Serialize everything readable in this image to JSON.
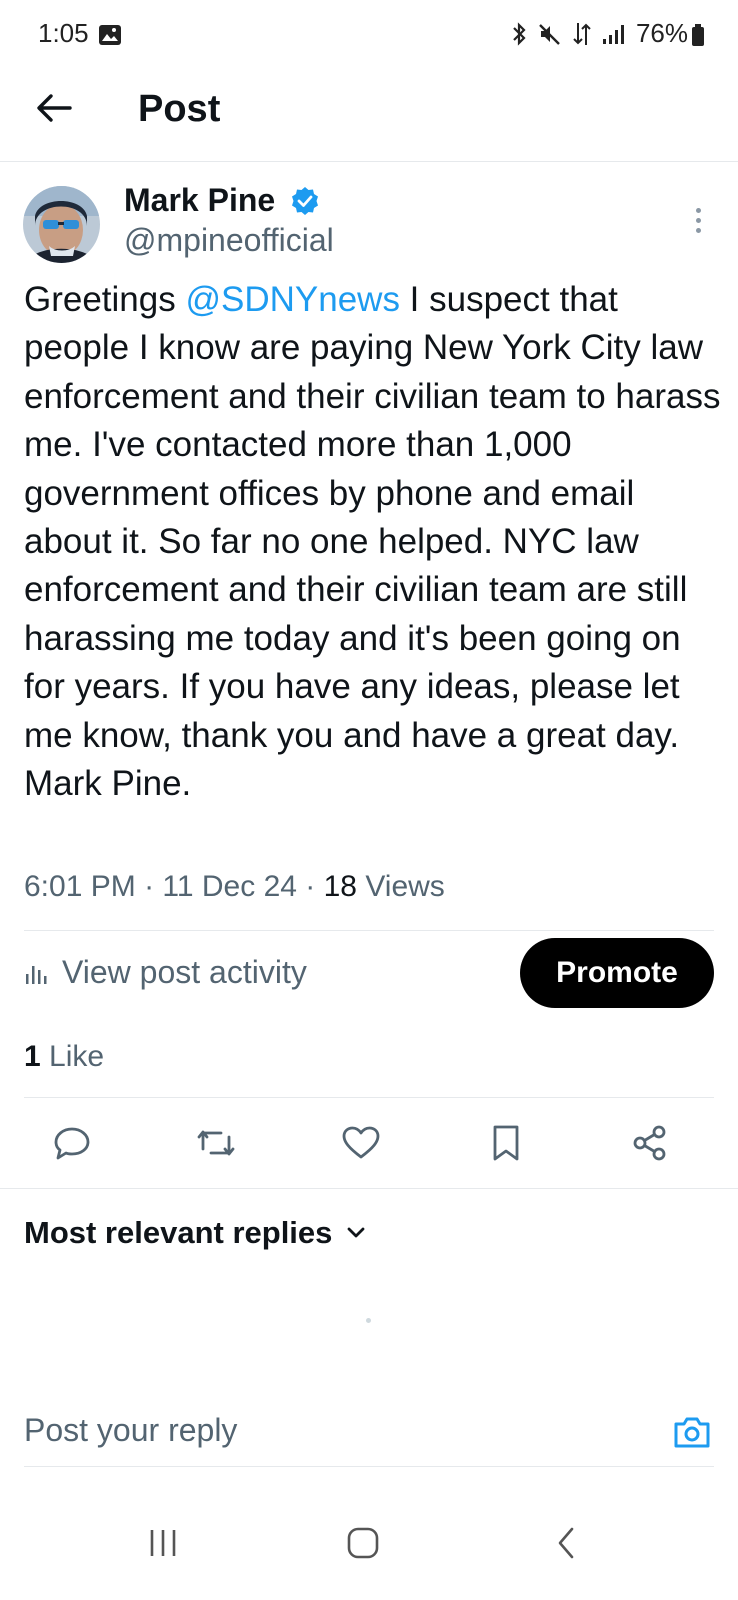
{
  "status_bar": {
    "time": "1:05",
    "battery": "76%",
    "icons": [
      "gallery-icon",
      "bluetooth-icon",
      "mute-icon",
      "data-icon",
      "signal-icon",
      "battery-icon"
    ]
  },
  "header": {
    "title": "Post",
    "back_icon": "back-arrow-icon"
  },
  "post": {
    "author_name": "Mark Pine",
    "author_handle": "@mpineofficial",
    "text_before_mention": "Greetings ",
    "mention": "@SDNYnews",
    "text_after_mention": " I suspect that people I know are paying New York City law enforcement and their civilian team to harass me. I've contacted more than 1,000 government offices by phone and email about it. So far no one helped. NYC law enforcement and their civilian team are still harassing me today and it's been going on for years. If you have any ideas, please let me know, thank you and have a great day. Mark Pine.",
    "time": "6:01 PM",
    "date": "11 Dec 24",
    "views_count": "18",
    "views_label": "Views"
  },
  "activity": {
    "view_activity_label": "View post activity",
    "promote_label": "Promote"
  },
  "likes": {
    "count": "1",
    "label": "Like"
  },
  "actions": [
    "reply-icon",
    "repost-icon",
    "like-icon",
    "bookmark-icon",
    "share-icon"
  ],
  "replies": {
    "sort_label": "Most relevant replies"
  },
  "reply_bar": {
    "placeholder": "Post your reply"
  },
  "colors": {
    "accent": "#1d9bf0",
    "text": "#0f1419",
    "muted": "#536471",
    "divider": "#e6e9ec"
  }
}
